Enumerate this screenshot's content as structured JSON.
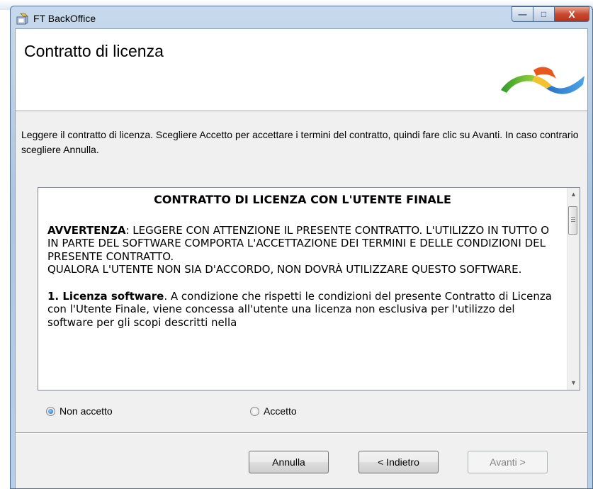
{
  "window": {
    "title": "FT BackOffice",
    "controls": {
      "minimize": "—",
      "maximize": "□",
      "close": "X"
    }
  },
  "header": {
    "title": "Contratto di licenza"
  },
  "instructions": "Leggere il contratto di licenza. Scegliere Accetto per accettare i termini del contratto, quindi fare clic su Avanti. In caso contrario scegliere Annulla.",
  "license": {
    "title": "CONTRATTO DI LICENZA CON L'UTENTE FINALE",
    "warning_label": "AVVERTENZA",
    "warning_text": ": LEGGERE CON ATTENZIONE IL PRESENTE CONTRATTO. L'UTILIZZO IN TUTTO O IN PARTE DEL SOFTWARE COMPORTA L'ACCETTAZIONE DEI TERMINI E DELLE CONDIZIONI DEL PRESENTE CONTRATTO.",
    "warning_text2": "QUALORA L'UTENTE NON SIA D'ACCORDO, NON DOVRÀ UTILIZZARE QUESTO SOFTWARE.",
    "section1_label": "1. Licenza software",
    "section1_text": ". A condizione che rispetti le condizioni del presente Contratto di Licenza con l'Utente Finale, viene concessa all'utente una licenza non esclusiva per l'utilizzo del software per gli scopi descritti nella"
  },
  "options": {
    "reject_label": "Non accetto",
    "accept_label": "Accetto",
    "selected": "reject"
  },
  "buttons": {
    "cancel": "Annulla",
    "back": "< Indietro",
    "next": "Avanti >"
  },
  "colors": {
    "accent": "#1b5fa8",
    "titlebar": "#b7cfe8",
    "close": "#c84a2e"
  }
}
